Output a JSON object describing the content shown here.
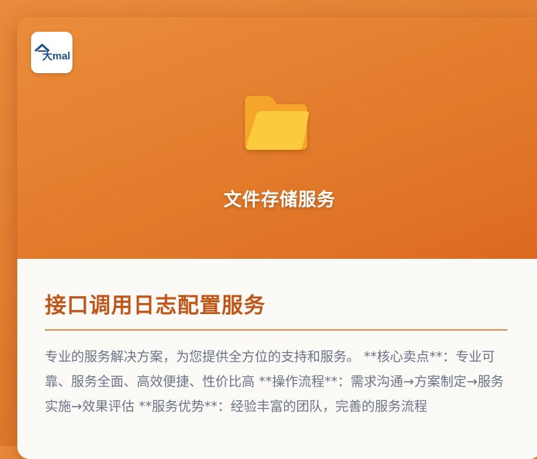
{
  "brand": {
    "logo_text": "大mall"
  },
  "hero": {
    "icon": "folder-icon",
    "title": "文件存储服务"
  },
  "service": {
    "title": "接口调用日志配置服务",
    "description": "专业的服务解决方案，为您提供全方位的支持和服务。 **核心卖点**：专业可靠、服务全面、高效便捷、性价比高 **操作流程**：需求沟通→方案制定→服务实施→效果评估 **服务优势**：经验丰富的团队，完善的服务流程"
  },
  "colors": {
    "accent": "#e27b2b",
    "title": "#c0561a",
    "divider": "#e4894a",
    "text": "#6b7388",
    "folder_back": "#f4a52c",
    "folder_front": "#fccb3e"
  }
}
